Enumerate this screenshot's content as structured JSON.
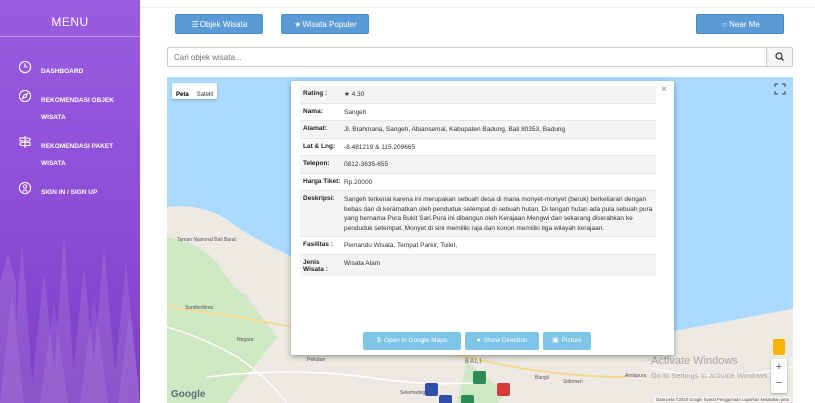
{
  "sidebar": {
    "menu_title": "MENU",
    "items": [
      {
        "label": "DASHBOARD",
        "icon": "clock-icon"
      },
      {
        "label": "REKOMENDASI OBJEK WISATA",
        "icon": "compass-icon"
      },
      {
        "label": "REKOMENDASI PAKET WISATA",
        "icon": "signpost-icon"
      },
      {
        "label": "SIGN IN / SIGN UP",
        "icon": "user-circle-icon"
      }
    ]
  },
  "toolbar": {
    "objek_wisata": "Objek Wisata",
    "wisata_populer": "Wisata Populer",
    "near_me": "Near Me"
  },
  "search": {
    "placeholder": "Cari objek wisata...",
    "icon": "search-icon"
  },
  "map": {
    "map_type_options": [
      "Peta",
      "Satelit"
    ],
    "selected_map_type": "Peta",
    "labels": {
      "taman": "Taman Nasional Bali Barat",
      "sumberkima": "Sumberkima",
      "negara": "Negara",
      "pekutan": "Pekutan",
      "bali": "BALI",
      "bangli": "Bangli",
      "amlapura": "Amlapura",
      "sidemen": "Sidemen",
      "selemadeg": "Selemadeg"
    },
    "google_logo": "Google",
    "attribution": "Data peta ©2018 Google   Syarat Penggunaan   Laporkan kesalahan peta",
    "watermark_title": "Activate Windows",
    "watermark_sub": "Go to Settings to activate Windows."
  },
  "popup": {
    "close": "×",
    "rows": [
      {
        "key": "Rating :",
        "value": "4.30"
      },
      {
        "key": "Nama:",
        "value": "Sangeh"
      },
      {
        "key": "Alamat:",
        "value": "Jl. Brahmana, Sangeh, Abiansemal, Kabupaten Badung, Bali 80353, Badung"
      },
      {
        "key": "Lat & Lng:",
        "value": "-8.481219 & 115.209665"
      },
      {
        "key": "Telepon:",
        "value": "0812-3635-655"
      },
      {
        "key": "Harga Tiket:",
        "value": "Rp.20000"
      },
      {
        "key": "Deskripsi:",
        "value": "Sangeh terkenal karena ini merupakan sebuah desa di mana monyet-monyet (beruk) berkeliaran dengan bebas dan di keramatkan oleh penduduk setempat di sebuah hutan. Di tengah hutan ada pula sebuah pura yang bernama Pura Bukit Sari.Pura ini dibangun oleh Kerajaan Mengwi dan sekarang diserahkan ke penduduk setempat. Monyet di sini memiliki raja dan konon memiliki tiga wilayah kerajaan."
      },
      {
        "key": "Fasilitas :",
        "value": "Pemandu Wisata, Tempat Parkir, Toilet,"
      },
      {
        "key": "Jenis Wisata :",
        "value": "Wisata Alam"
      }
    ],
    "buttons": {
      "maps": "Open in Google Maps",
      "direction": "Show Direction",
      "picture": "Picture"
    }
  },
  "colors": {
    "sidebar": "#8f4fd8",
    "button": "#5b9bd5",
    "popup_button": "#7ec4e6"
  }
}
